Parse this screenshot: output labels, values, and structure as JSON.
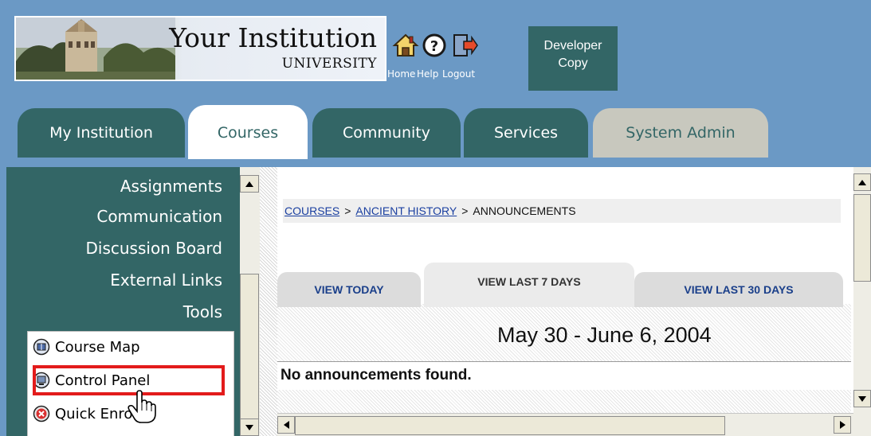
{
  "header": {
    "logo_line1": "Your Institution",
    "logo_line2": "UNIVERSITY",
    "home_label": "Home",
    "help_label": "Help",
    "logout_label": "Logout",
    "developer_line1": "Developer",
    "developer_line2": "Copy"
  },
  "tabs": [
    {
      "label": "My Institution",
      "state": "inactive"
    },
    {
      "label": "Courses",
      "state": "active"
    },
    {
      "label": "Community",
      "state": "inactive"
    },
    {
      "label": "Services",
      "state": "inactive"
    },
    {
      "label": "System Admin",
      "state": "disabled"
    }
  ],
  "sidebar": {
    "items": [
      {
        "label": "Assignments"
      },
      {
        "label": "Communication"
      },
      {
        "label": "Discussion Board"
      },
      {
        "label": "External Links"
      },
      {
        "label": "Tools"
      }
    ],
    "tools": [
      {
        "label": "Course Map",
        "icon": "course-map-icon"
      },
      {
        "label": "Control Panel",
        "icon": "control-panel-icon",
        "highlighted": true
      },
      {
        "label": "Quick Enroll",
        "icon": "quick-enroll-icon"
      }
    ]
  },
  "breadcrumb": {
    "level1": "COURSES",
    "level2": "ANCIENT HISTORY",
    "level3": "ANNOUNCEMENTS",
    "separator": ">"
  },
  "announcements": {
    "view_tabs": [
      {
        "label": "VIEW TODAY",
        "active": false
      },
      {
        "label": "VIEW LAST 7 DAYS",
        "active": true
      },
      {
        "label": "VIEW LAST 30 DAYS",
        "active": false
      }
    ],
    "date_range": "May 30 - June 6, 2004",
    "empty_message": "No announcements found."
  },
  "colors": {
    "frame_blue": "#6b99c5",
    "teal": "#336666",
    "highlight_red": "#e31b1b",
    "link_blue": "#1a3fa0"
  }
}
